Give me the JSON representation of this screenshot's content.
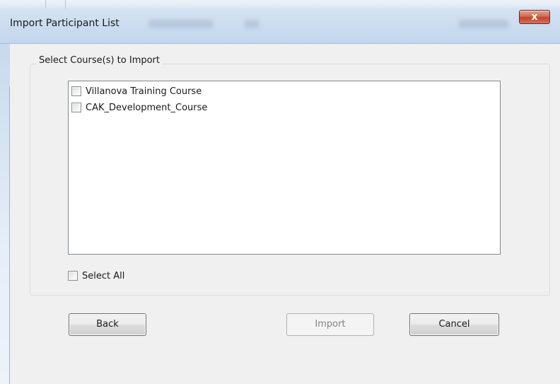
{
  "window": {
    "title": "Import Participant List",
    "close_label": "x"
  },
  "group": {
    "legend": "Select Course(s) to Import"
  },
  "courses": [
    {
      "label": "Villanova Training Course",
      "checked": false
    },
    {
      "label": "CAK_Development_Course",
      "checked": false
    }
  ],
  "select_all": {
    "label": "Select All",
    "checked": false
  },
  "buttons": {
    "back": "Back",
    "import": "Import",
    "cancel": "Cancel"
  },
  "colors": {
    "client_bg": "#f0f0f0",
    "close_button": "#c0432c",
    "disabled_text": "#838383"
  }
}
